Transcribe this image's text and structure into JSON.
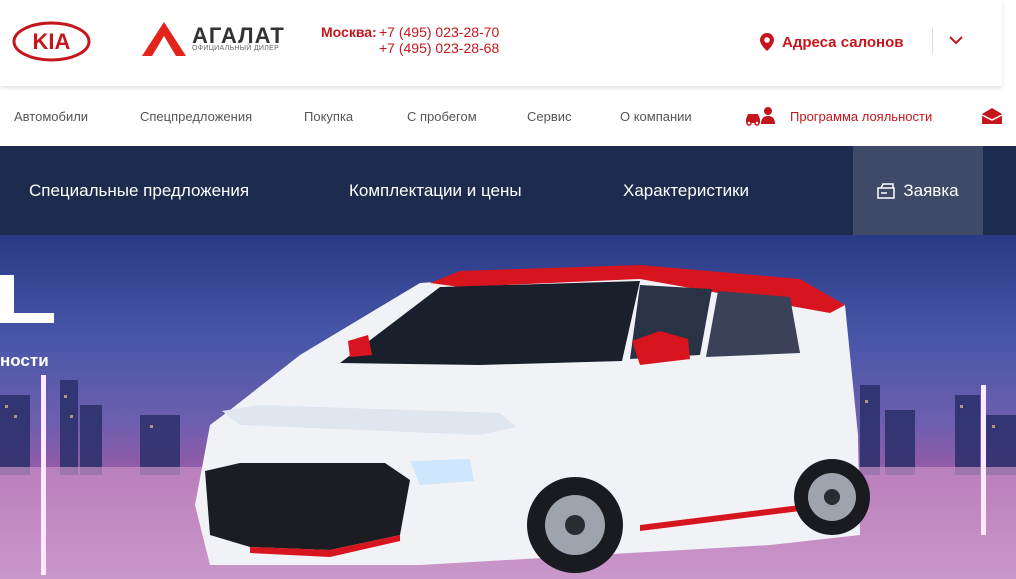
{
  "header": {
    "brand_logo": "KIA",
    "dealer_name": "АГАЛАТ",
    "dealer_subtitle": "ОФИЦИАЛЬНЫЙ ДИЛЕР",
    "city_label": "Москва:",
    "phones": [
      "+7 (495) 023-28-70",
      "+7 (495) 023-28-68"
    ],
    "addresses_label": "Адреса салонов"
  },
  "nav": {
    "items": [
      "Автомобили",
      "Спецпредложения",
      "Покупка",
      "С пробегом",
      "Сервис",
      "О компании"
    ],
    "loyalty_label": "Программа лояльности"
  },
  "tabs": {
    "items": [
      "Специальные предложения",
      "Комплектации и цены",
      "Характеристики"
    ],
    "request_label": "Заявка"
  },
  "hero": {
    "caption": "ности"
  },
  "colors": {
    "brand_red": "#c5161d",
    "tabs_bg": "#1d2b4f",
    "active_tab_bg": "#3e4a67"
  }
}
